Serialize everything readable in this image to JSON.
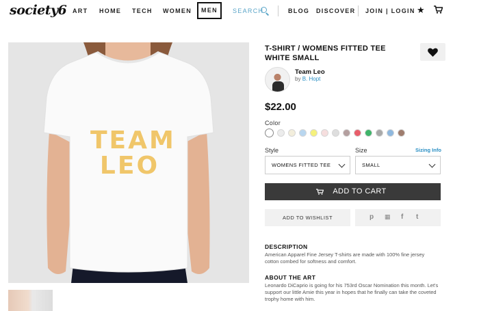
{
  "nav": {
    "logo": "society6",
    "items": [
      "ART",
      "HOME",
      "TECH",
      "WOMEN",
      "MEN"
    ],
    "search": "SEARCH",
    "blog": "BLOG",
    "discover": "DISCOVER",
    "join_login": "JOIN | LOGIN"
  },
  "product": {
    "title": "T-SHIRT / WOMENS FITTED TEE WHITE SMALL",
    "shirt_text_line1": "TEAM",
    "shirt_text_line2": "LEO",
    "artist": "Team Leo",
    "by_prefix": "by",
    "by_author": "B. Hopt",
    "price": "$22.00",
    "color_label": "Color",
    "colors": [
      "#ffffff",
      "#ececec",
      "#f3eedc",
      "#b8d6ef",
      "#f5f17c",
      "#f6dede",
      "#dedede",
      "#b49f9f",
      "#e85d6a",
      "#3fb46a",
      "#a9a9a9",
      "#8fb8de",
      "#9f7d6e"
    ],
    "style_label": "Style",
    "style_value": "WOMENS FITTED TEE",
    "size_label": "Size",
    "sizing_info": "Sizing Info",
    "size_value": "SMALL",
    "add_to_cart": "ADD TO CART",
    "add_to_wishlist": "ADD TO WISHLIST",
    "share_icons": [
      "p",
      "▦",
      "f",
      "t"
    ]
  },
  "description": {
    "heading": "DESCRIPTION",
    "text": "American Apparel Fine Jersey T-shirts are made with 100% fine jersey cotton combed for softness and comfort."
  },
  "about": {
    "heading": "ABOUT THE ART",
    "text": "Leonardo DiCaprio is going for his 753rd Oscar Nomination this month. Let's support our little Amie this year in hopes that he finally can take the coveted trophy home with him."
  }
}
